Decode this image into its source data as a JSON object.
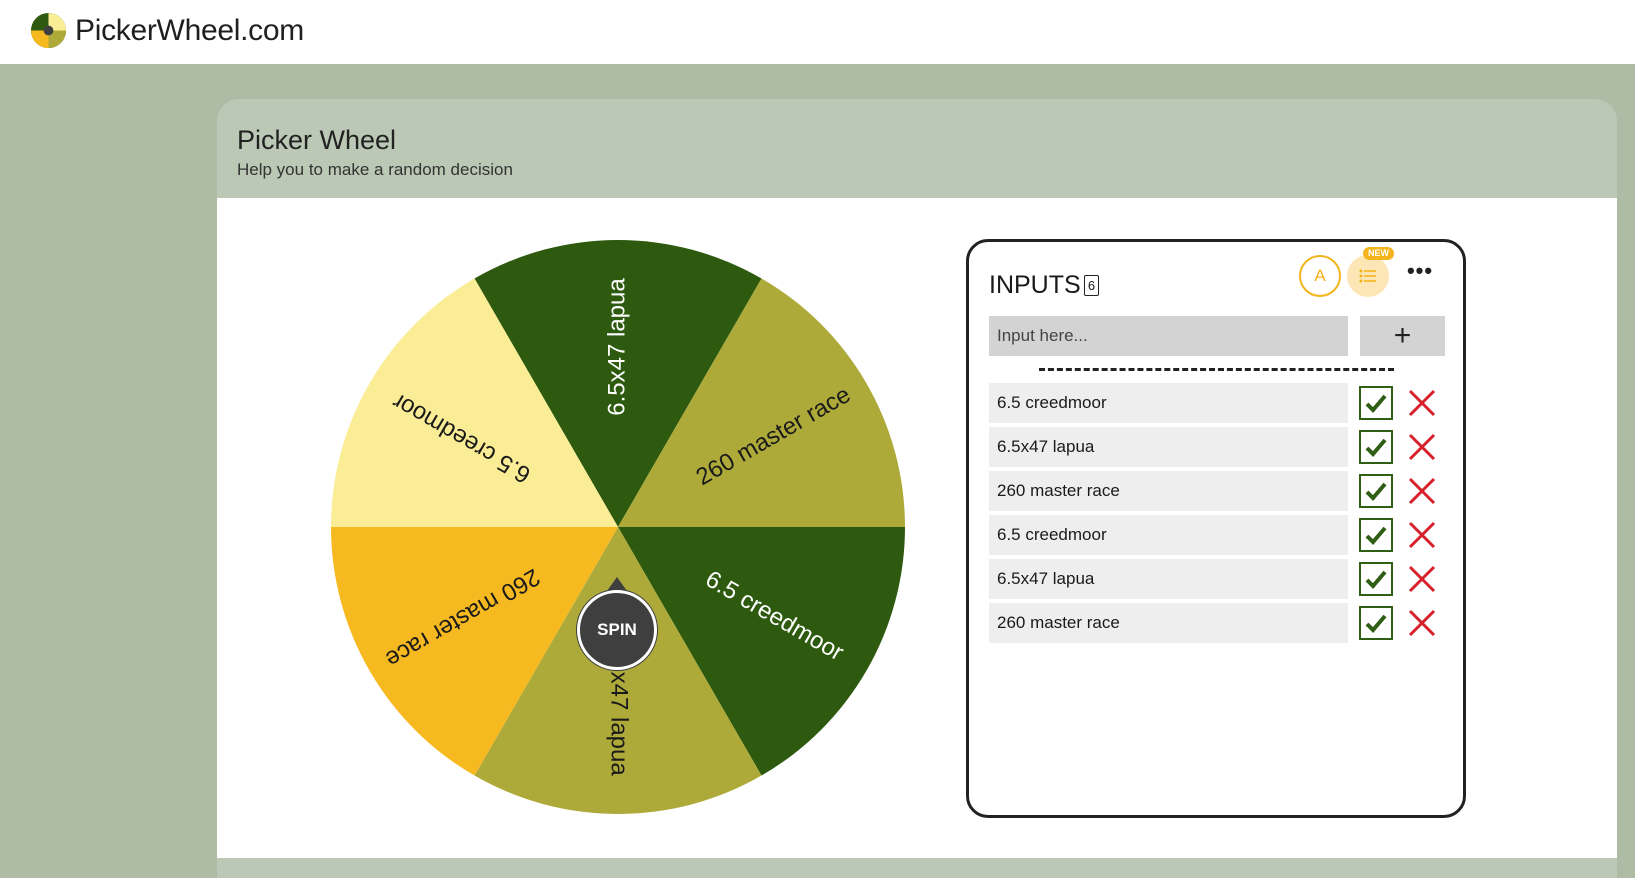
{
  "site": {
    "brand": "PickerWheel.com"
  },
  "tool": {
    "title": "Picker Wheel",
    "subtitle": "Help you to make a random decision"
  },
  "wheel": {
    "spin_label": "SPIN",
    "slices": [
      {
        "label": "6.5x47 lapua",
        "color": "#2d5a0e",
        "text_color": "#ffffff"
      },
      {
        "label": "260 master race",
        "color": "#aeaa3a",
        "text_color": "#1a1a1a"
      },
      {
        "label": "6.5 creedmoor",
        "color": "#2d5a0e",
        "text_color": "#ffffff"
      },
      {
        "label": "6.5x47 lapua",
        "color": "#aeaa3a",
        "text_color": "#1a1a1a"
      },
      {
        "label": "260 master race",
        "color": "#f6b920",
        "text_color": "#1a1a1a"
      },
      {
        "label": "6.5 creedmoor",
        "color": "#fbed95",
        "text_color": "#1a1a1a"
      }
    ]
  },
  "inputs": {
    "title": "INPUTS",
    "count": "6",
    "a_button": "A",
    "new_badge": "NEW",
    "more": "•••",
    "placeholder": "Input here...",
    "add": "+",
    "items": [
      {
        "label": "6.5 creedmoor"
      },
      {
        "label": "6.5x47 lapua"
      },
      {
        "label": "260 master race"
      },
      {
        "label": "6.5 creedmoor"
      },
      {
        "label": "6.5x47 lapua"
      },
      {
        "label": "260 master race"
      }
    ]
  },
  "colors": {
    "accent": "#f4b41b",
    "check": "#2f5e14",
    "remove": "#d6202a"
  }
}
